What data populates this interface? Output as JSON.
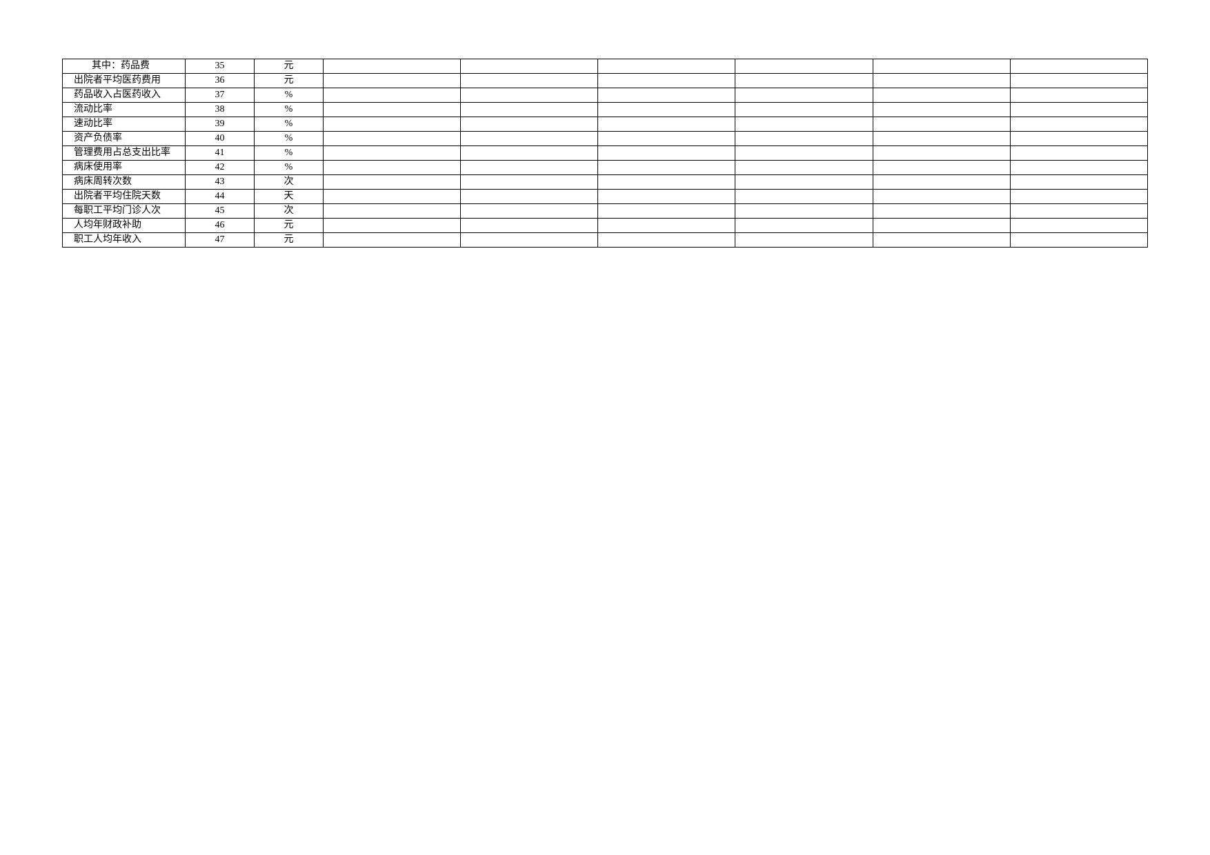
{
  "rows": [
    {
      "name": "其中：药品费",
      "num": "35",
      "unit": "元",
      "indent": true
    },
    {
      "name": "出院者平均医药费用",
      "num": "36",
      "unit": "元",
      "indent": false
    },
    {
      "name": "药品收入占医药收入",
      "num": "37",
      "unit": "%",
      "indent": false
    },
    {
      "name": "流动比率",
      "num": "38",
      "unit": "%",
      "indent": false
    },
    {
      "name": "速动比率",
      "num": "39",
      "unit": "%",
      "indent": false
    },
    {
      "name": "资产负债率",
      "num": "40",
      "unit": "%",
      "indent": false
    },
    {
      "name": "管理费用占总支出比率",
      "num": "41",
      "unit": "%",
      "indent": false
    },
    {
      "name": "病床使用率",
      "num": "42",
      "unit": "%",
      "indent": false
    },
    {
      "name": "病床周转次数",
      "num": "43",
      "unit": "次",
      "indent": false
    },
    {
      "name": "出院者平均住院天数",
      "num": "44",
      "unit": "天",
      "indent": false
    },
    {
      "name": "每职工平均门诊人次",
      "num": "45",
      "unit": "次",
      "indent": false
    },
    {
      "name": "人均年财政补助",
      "num": "46",
      "unit": "元",
      "indent": false
    },
    {
      "name": "职工人均年收入",
      "num": "47",
      "unit": "元",
      "indent": false
    }
  ]
}
